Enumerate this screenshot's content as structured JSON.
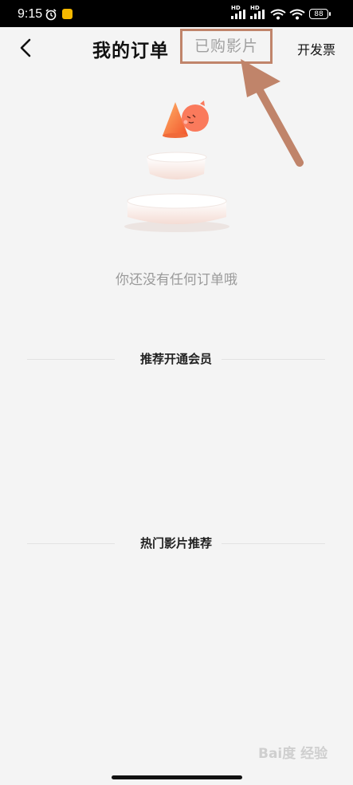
{
  "status_bar": {
    "time": "9:15",
    "battery": "88",
    "hd_label": "HD"
  },
  "header": {
    "title": "我的订单",
    "purchased_tab": "已购影片",
    "invoice_button": "开发票"
  },
  "empty_state": {
    "message": "你还没有任何订单哦"
  },
  "sections": {
    "membership": "推荐开通会员",
    "hot_movies": "热门影片推荐"
  },
  "watermark": {
    "text": "Bai度 经验"
  },
  "colors": {
    "background": "#f4f4f4",
    "annotation": "#c0846a",
    "accent_orange": "#f26a2e"
  },
  "icons": [
    "back-arrow-icon",
    "alarm-icon",
    "signal-icon",
    "wifi-icon",
    "battery-icon",
    "annotation-arrow"
  ]
}
